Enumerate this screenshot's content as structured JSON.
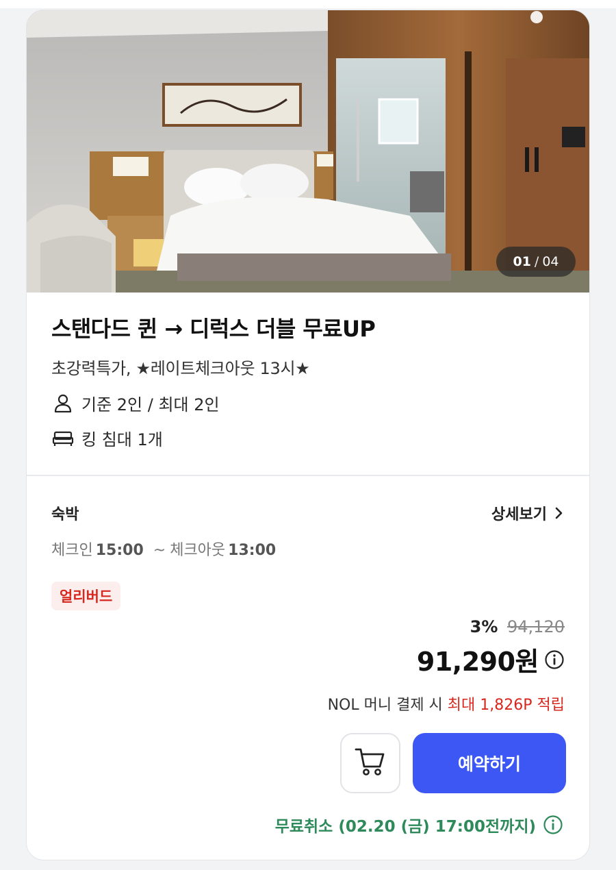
{
  "gallery": {
    "current": "01",
    "separator": "/",
    "total": "04",
    "image": "hotel-room-photo"
  },
  "room": {
    "title": "스탠다드 퀸 → 디럭스 더블 무료UP",
    "subtitle": "초강력특가, ★레이트체크아웃 13시★",
    "capacity": "기준 2인 / 최대 2인",
    "bed": "킹 침대 1개"
  },
  "stay": {
    "label": "숙박",
    "detail_link": "상세보기",
    "checkin_label": "체크인",
    "checkin_time": "15:00",
    "tilde": "~",
    "checkout_label": "체크아웃",
    "checkout_time": "13:00"
  },
  "badge": "얼리버드",
  "pricing": {
    "discount": "3%",
    "original": "94,120",
    "price": "91,290원",
    "points_prefix": "NOL 머니 결제 시",
    "points_highlight": "최대 1,826P 적립"
  },
  "actions": {
    "book": "예약하기"
  },
  "cancellation": "무료취소 (02.20 (금) 17:00전까지)",
  "icons": [
    "person-icon",
    "bed-icon",
    "chevron-right-icon",
    "info-icon",
    "cart-icon"
  ],
  "colors": {
    "accent": "#3d57f5",
    "sale_red": "#d6281f",
    "cancel_green": "#2e8a5a"
  }
}
